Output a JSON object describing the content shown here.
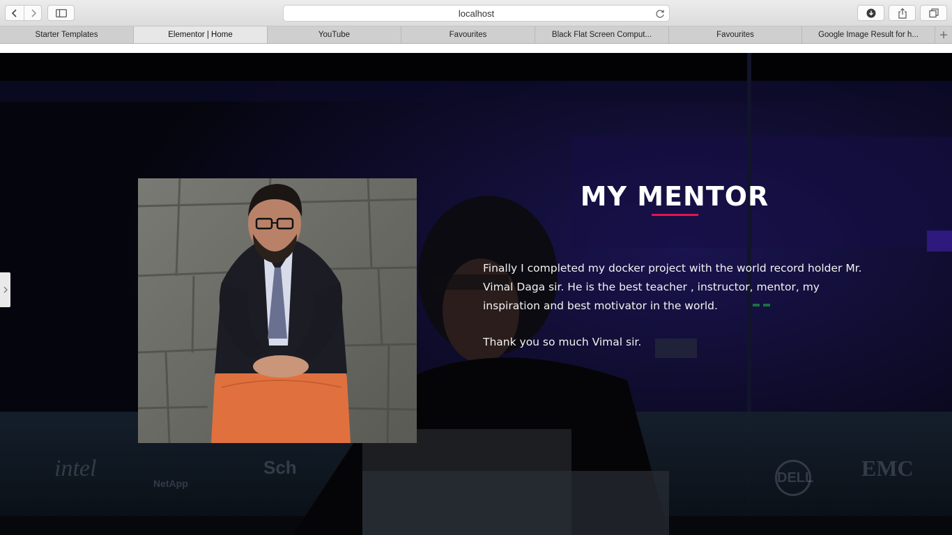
{
  "browser": {
    "url": "localhost",
    "tabs": [
      {
        "label": "Starter Templates",
        "active": false
      },
      {
        "label": "Elementor | Home",
        "active": true
      },
      {
        "label": "YouTube",
        "active": false
      },
      {
        "label": "Favourites",
        "active": false
      },
      {
        "label": "Black Flat Screen Comput...",
        "active": false
      },
      {
        "label": "Favourites",
        "active": false
      },
      {
        "label": "Google Image Result for h...",
        "active": false
      }
    ]
  },
  "section": {
    "title": "MY MENTOR",
    "body": "Finally I completed my docker project with the world record holder Mr. Vimal Daga sir. He is the best teacher , instructor, mentor, my inspiration and best motivator in the world.",
    "closing": "Thank you so much Vimal sir."
  },
  "background_logos": [
    "intel",
    "NetApp",
    "Sch",
    "DELL",
    "EMC"
  ],
  "colors": {
    "accent": "#e0154f",
    "hero_bg": "#05050d"
  }
}
